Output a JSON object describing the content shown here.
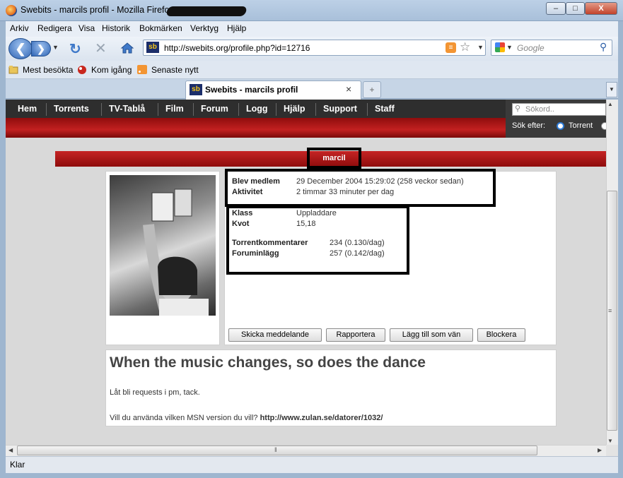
{
  "window": {
    "title": "Swebits - marcils profil - Mozilla Firefox",
    "min": "–",
    "max": "□",
    "close": "X"
  },
  "menu": [
    "Arkiv",
    "Redigera",
    "Visa",
    "Historik",
    "Bokmärken",
    "Verktyg",
    "Hjälp"
  ],
  "toolbar": {
    "url": "http://swebits.org/profile.php?id=12716",
    "search_placeholder": "Google",
    "site_icon": "sb"
  },
  "bookmarks": [
    {
      "label": "Mest besökta",
      "icon": "bookmark-folder-icon"
    },
    {
      "label": "Kom igång",
      "icon": "firefox-start-icon"
    },
    {
      "label": "Senaste nytt",
      "icon": "rss-feed-icon"
    }
  ],
  "tab": {
    "label": "Swebits - marcils profil",
    "close": "×",
    "new": "+"
  },
  "site_nav": [
    "Hem",
    "Torrents",
    "TV-Tablå",
    "Film",
    "Forum",
    "Logg",
    "Hjälp",
    "Support",
    "Staff"
  ],
  "site_search": {
    "placeholder": "Sökord..",
    "label": "Sök efter:",
    "option": "Torrent"
  },
  "profile": {
    "username": "marcil",
    "member_since_label": "Blev medlem",
    "member_since": "29 December 2004 15:29:02 (258 veckor sedan)",
    "activity_label": "Aktivitet",
    "activity": "2 timmar 33 minuter per dag",
    "class_label": "Klass",
    "class": "Uppladdare",
    "ratio_label": "Kvot",
    "ratio": "15,18",
    "torrent_comments_label": "Torrentkommentarer",
    "torrent_comments": "234 (0.130/dag)",
    "forum_posts_label": "Foruminlägg",
    "forum_posts": "257 (0.142/dag)",
    "buttons": {
      "message": "Skicka meddelande",
      "report": "Rapportera",
      "add_friend": "Lägg till som vän",
      "block": "Blockera"
    },
    "bio_title": "When the music changes, so does the dance",
    "bio_line1": "Låt bli requests i pm, tack.",
    "bio_line2": "Vill du använda vilken MSN version du vill?",
    "bio_link": "http://www.zulan.se/datorer/1032/"
  },
  "status": "Klar",
  "colors": {
    "nav_bg": "#2e2e2e",
    "brand_red": "#b51a1a",
    "page_bg": "#d9d9d9"
  }
}
